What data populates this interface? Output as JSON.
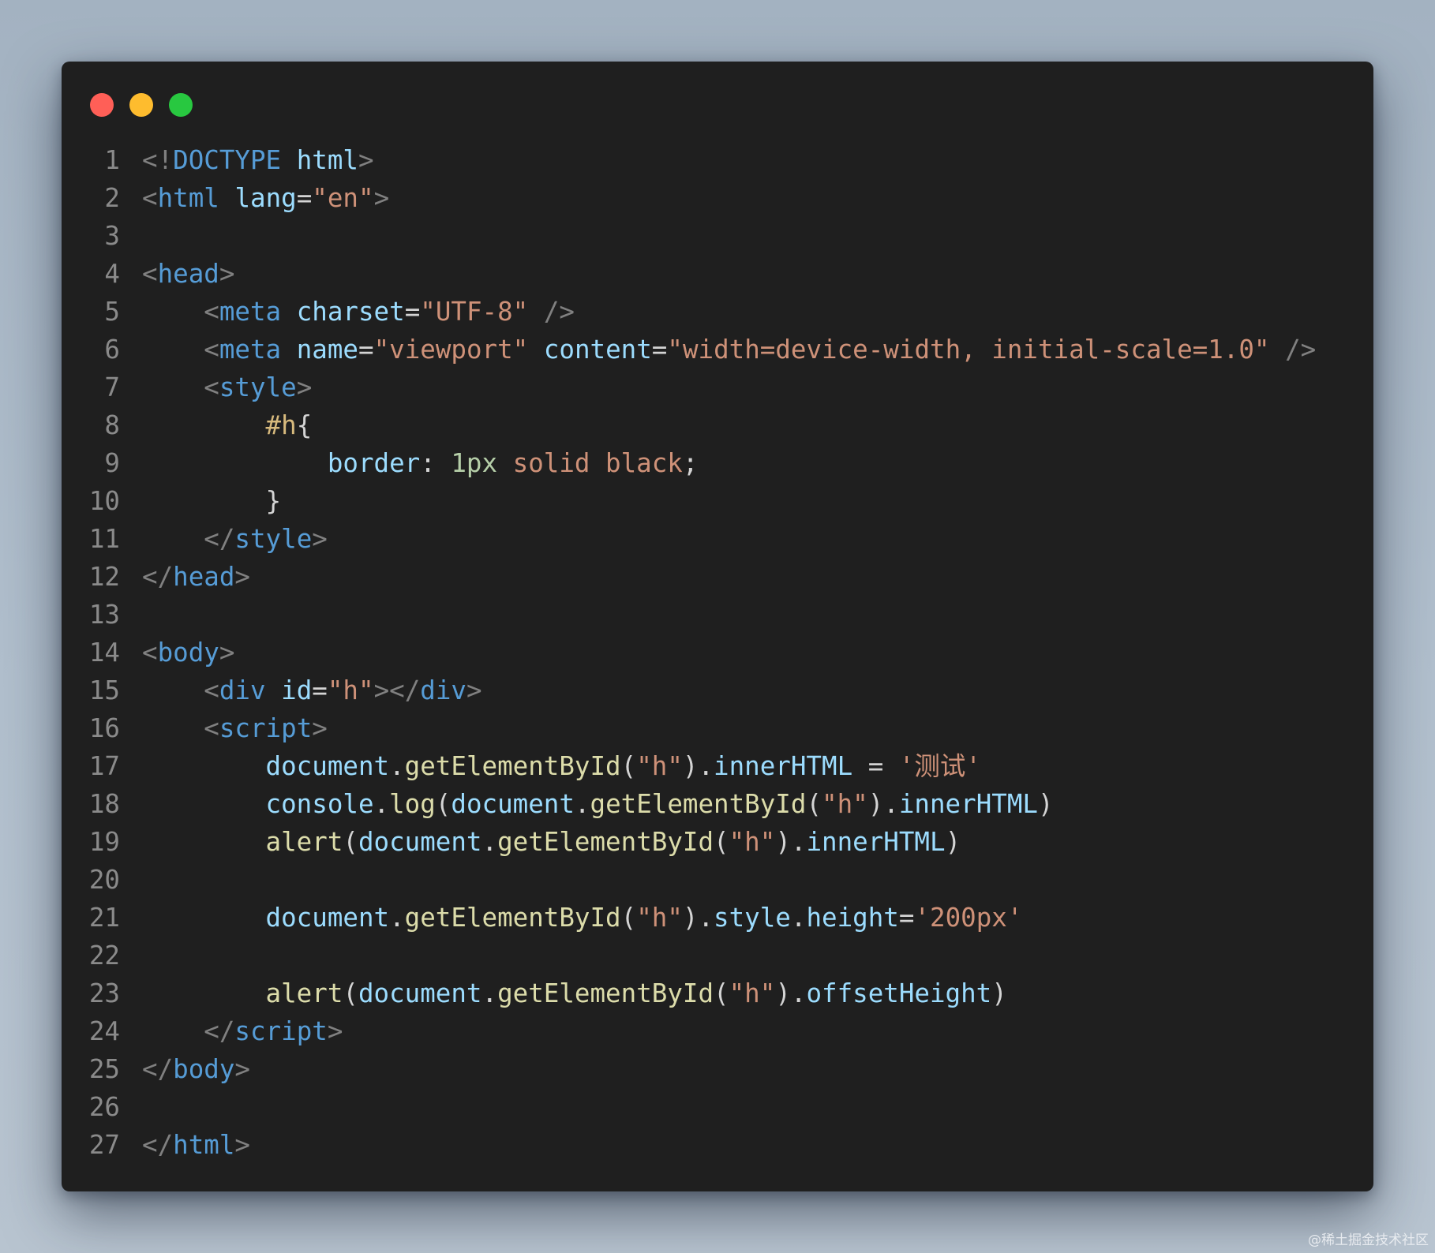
{
  "window": {
    "traffic_lights": [
      {
        "name": "close",
        "color": "#ff5f57"
      },
      {
        "name": "minimize",
        "color": "#febc2e"
      },
      {
        "name": "maximize",
        "color": "#28c840"
      }
    ]
  },
  "code": {
    "lines": [
      {
        "n": "1",
        "tokens": [
          [
            "t-punc",
            "<!"
          ],
          [
            "t-tag",
            "DOCTYPE"
          ],
          [
            "t-plain",
            " "
          ],
          [
            "t-attr",
            "html"
          ],
          [
            "t-punc",
            ">"
          ]
        ]
      },
      {
        "n": "2",
        "tokens": [
          [
            "t-punc",
            "<"
          ],
          [
            "t-tag",
            "html"
          ],
          [
            "t-plain",
            " "
          ],
          [
            "t-attr",
            "lang"
          ],
          [
            "t-op",
            "="
          ],
          [
            "t-str",
            "\"en\""
          ],
          [
            "t-punc",
            ">"
          ]
        ]
      },
      {
        "n": "3",
        "tokens": []
      },
      {
        "n": "4",
        "tokens": [
          [
            "t-punc",
            "<"
          ],
          [
            "t-tag",
            "head"
          ],
          [
            "t-punc",
            ">"
          ]
        ]
      },
      {
        "n": "5",
        "tokens": [
          [
            "t-plain",
            "    "
          ],
          [
            "t-punc",
            "<"
          ],
          [
            "t-tag",
            "meta"
          ],
          [
            "t-plain",
            " "
          ],
          [
            "t-attr",
            "charset"
          ],
          [
            "t-op",
            "="
          ],
          [
            "t-str",
            "\"UTF-8\""
          ],
          [
            "t-plain",
            " "
          ],
          [
            "t-punc",
            "/>"
          ]
        ]
      },
      {
        "n": "6",
        "tokens": [
          [
            "t-plain",
            "    "
          ],
          [
            "t-punc",
            "<"
          ],
          [
            "t-tag",
            "meta"
          ],
          [
            "t-plain",
            " "
          ],
          [
            "t-attr",
            "name"
          ],
          [
            "t-op",
            "="
          ],
          [
            "t-str",
            "\"viewport\""
          ],
          [
            "t-plain",
            " "
          ],
          [
            "t-attr",
            "content"
          ],
          [
            "t-op",
            "="
          ],
          [
            "t-str",
            "\"width=device-width, initial-scale=1.0\""
          ],
          [
            "t-plain",
            " "
          ],
          [
            "t-punc",
            "/>"
          ]
        ]
      },
      {
        "n": "7",
        "tokens": [
          [
            "t-plain",
            "    "
          ],
          [
            "t-punc",
            "<"
          ],
          [
            "t-tag",
            "style"
          ],
          [
            "t-punc",
            ">"
          ]
        ]
      },
      {
        "n": "8",
        "tokens": [
          [
            "t-plain",
            "        "
          ],
          [
            "t-sel",
            "#h"
          ],
          [
            "t-plain",
            "{"
          ]
        ]
      },
      {
        "n": "9",
        "tokens": [
          [
            "t-plain",
            "            "
          ],
          [
            "t-prop",
            "border"
          ],
          [
            "t-plain",
            ": "
          ],
          [
            "t-num",
            "1px"
          ],
          [
            "t-plain",
            " "
          ],
          [
            "t-str",
            "solid black"
          ],
          [
            "t-plain",
            ";"
          ]
        ]
      },
      {
        "n": "10",
        "tokens": [
          [
            "t-plain",
            "        }"
          ]
        ]
      },
      {
        "n": "11",
        "tokens": [
          [
            "t-plain",
            "    "
          ],
          [
            "t-punc",
            "</"
          ],
          [
            "t-tag",
            "style"
          ],
          [
            "t-punc",
            ">"
          ]
        ]
      },
      {
        "n": "12",
        "tokens": [
          [
            "t-punc",
            "</"
          ],
          [
            "t-tag",
            "head"
          ],
          [
            "t-punc",
            ">"
          ]
        ]
      },
      {
        "n": "13",
        "tokens": []
      },
      {
        "n": "14",
        "tokens": [
          [
            "t-punc",
            "<"
          ],
          [
            "t-tag",
            "body"
          ],
          [
            "t-punc",
            ">"
          ]
        ]
      },
      {
        "n": "15",
        "tokens": [
          [
            "t-plain",
            "    "
          ],
          [
            "t-punc",
            "<"
          ],
          [
            "t-tag",
            "div"
          ],
          [
            "t-plain",
            " "
          ],
          [
            "t-attr",
            "id"
          ],
          [
            "t-op",
            "="
          ],
          [
            "t-str",
            "\"h\""
          ],
          [
            "t-punc",
            "></"
          ],
          [
            "t-tag",
            "div"
          ],
          [
            "t-punc",
            ">"
          ]
        ]
      },
      {
        "n": "16",
        "tokens": [
          [
            "t-plain",
            "    "
          ],
          [
            "t-punc",
            "<"
          ],
          [
            "t-tag",
            "script"
          ],
          [
            "t-punc",
            ">"
          ]
        ]
      },
      {
        "n": "17",
        "tokens": [
          [
            "t-plain",
            "        "
          ],
          [
            "t-var",
            "document"
          ],
          [
            "t-plain",
            "."
          ],
          [
            "t-fn",
            "getElementById"
          ],
          [
            "t-plain",
            "("
          ],
          [
            "t-str",
            "\"h\""
          ],
          [
            "t-plain",
            ")."
          ],
          [
            "t-var",
            "innerHTML"
          ],
          [
            "t-plain",
            " = "
          ],
          [
            "t-str",
            "'测试'"
          ]
        ]
      },
      {
        "n": "18",
        "tokens": [
          [
            "t-plain",
            "        "
          ],
          [
            "t-var",
            "console"
          ],
          [
            "t-plain",
            "."
          ],
          [
            "t-fn",
            "log"
          ],
          [
            "t-plain",
            "("
          ],
          [
            "t-var",
            "document"
          ],
          [
            "t-plain",
            "."
          ],
          [
            "t-fn",
            "getElementById"
          ],
          [
            "t-plain",
            "("
          ],
          [
            "t-str",
            "\"h\""
          ],
          [
            "t-plain",
            ")."
          ],
          [
            "t-var",
            "innerHTML"
          ],
          [
            "t-plain",
            ")"
          ]
        ]
      },
      {
        "n": "19",
        "tokens": [
          [
            "t-plain",
            "        "
          ],
          [
            "t-fn",
            "alert"
          ],
          [
            "t-plain",
            "("
          ],
          [
            "t-var",
            "document"
          ],
          [
            "t-plain",
            "."
          ],
          [
            "t-fn",
            "getElementById"
          ],
          [
            "t-plain",
            "("
          ],
          [
            "t-str",
            "\"h\""
          ],
          [
            "t-plain",
            ")."
          ],
          [
            "t-var",
            "innerHTML"
          ],
          [
            "t-plain",
            ")"
          ]
        ]
      },
      {
        "n": "20",
        "tokens": []
      },
      {
        "n": "21",
        "tokens": [
          [
            "t-plain",
            "        "
          ],
          [
            "t-var",
            "document"
          ],
          [
            "t-plain",
            "."
          ],
          [
            "t-fn",
            "getElementById"
          ],
          [
            "t-plain",
            "("
          ],
          [
            "t-str",
            "\"h\""
          ],
          [
            "t-plain",
            ")."
          ],
          [
            "t-var",
            "style"
          ],
          [
            "t-plain",
            "."
          ],
          [
            "t-var",
            "height"
          ],
          [
            "t-plain",
            "="
          ],
          [
            "t-str",
            "'200px'"
          ]
        ]
      },
      {
        "n": "22",
        "tokens": []
      },
      {
        "n": "23",
        "tokens": [
          [
            "t-plain",
            "        "
          ],
          [
            "t-fn",
            "alert"
          ],
          [
            "t-plain",
            "("
          ],
          [
            "t-var",
            "document"
          ],
          [
            "t-plain",
            "."
          ],
          [
            "t-fn",
            "getElementById"
          ],
          [
            "t-plain",
            "("
          ],
          [
            "t-str",
            "\"h\""
          ],
          [
            "t-plain",
            ")."
          ],
          [
            "t-var",
            "offsetHeight"
          ],
          [
            "t-plain",
            ")"
          ]
        ]
      },
      {
        "n": "24",
        "tokens": [
          [
            "t-plain",
            "    "
          ],
          [
            "t-punc",
            "</"
          ],
          [
            "t-tag",
            "script"
          ],
          [
            "t-punc",
            ">"
          ]
        ]
      },
      {
        "n": "25",
        "tokens": [
          [
            "t-punc",
            "</"
          ],
          [
            "t-tag",
            "body"
          ],
          [
            "t-punc",
            ">"
          ]
        ]
      },
      {
        "n": "26",
        "tokens": []
      },
      {
        "n": "27",
        "tokens": [
          [
            "t-punc",
            "</"
          ],
          [
            "t-tag",
            "html"
          ],
          [
            "t-punc",
            ">"
          ]
        ]
      }
    ]
  },
  "watermark": "@稀土掘金技术社区"
}
